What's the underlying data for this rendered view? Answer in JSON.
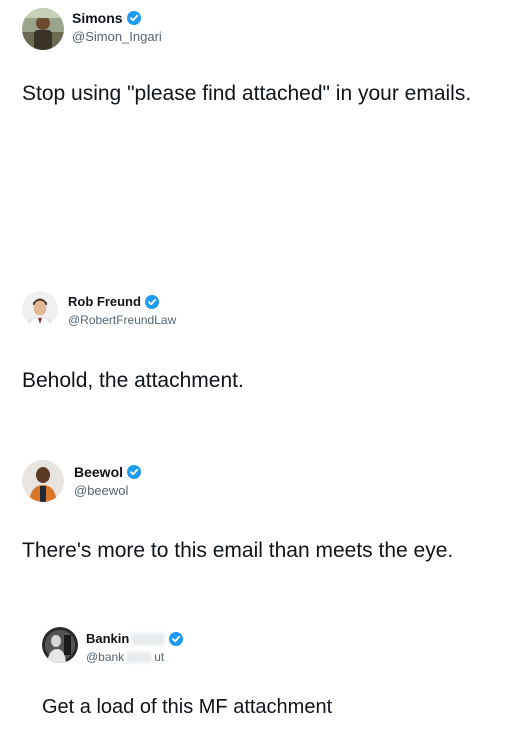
{
  "posts": [
    {
      "name": "Simons",
      "handle": "@Simon_Ingari",
      "text": "Stop using \"please find attached\" in your emails.",
      "verified": true,
      "avatar_icon": "person-avatar-outdoor"
    },
    {
      "name": "Rob Freund",
      "handle": "@RobertFreundLaw",
      "text": "Behold, the attachment.",
      "verified": true,
      "avatar_icon": "person-avatar-portrait"
    },
    {
      "name": "Beewol",
      "handle": "@beewol",
      "text": "There's more to this email than meets the eye.",
      "verified": true,
      "avatar_icon": "person-avatar-orange"
    },
    {
      "name": "Bankin",
      "handle_visible": "@bank",
      "handle_tail": "ut",
      "text": "Get a load of this MF attachment",
      "verified": true,
      "avatar_icon": "person-avatar-bw"
    }
  ],
  "colors": {
    "verified": "#1d9bf0",
    "text": "#0f1419",
    "handle": "#536471"
  }
}
